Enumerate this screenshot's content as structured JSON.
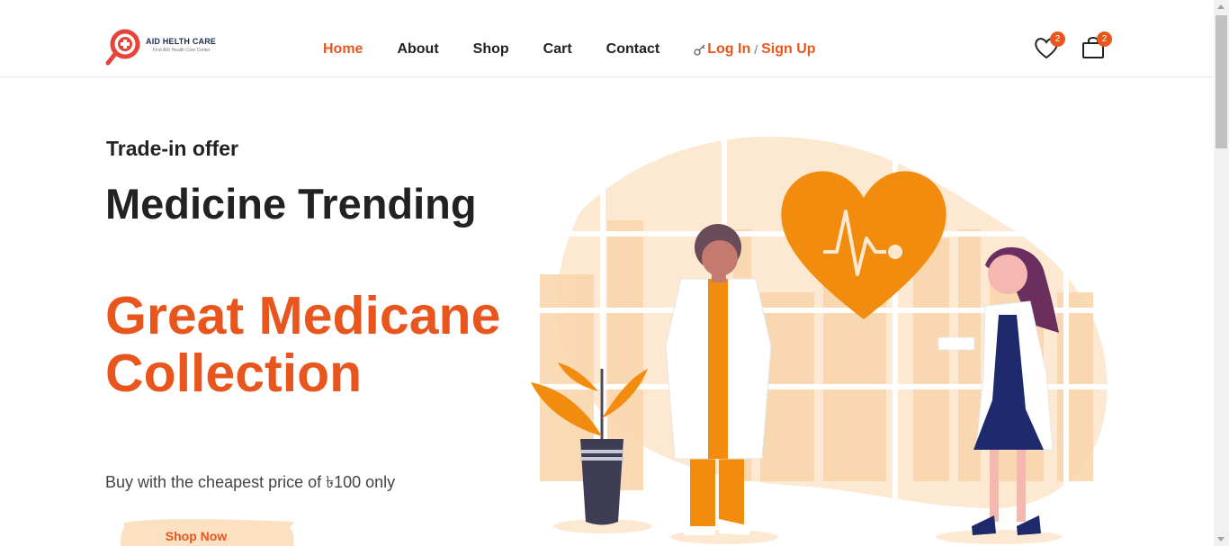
{
  "brand": {
    "name": "AID HELTH CARE",
    "tagline": "First AID Health Care Center"
  },
  "nav": {
    "home": "Home",
    "about": "About",
    "shop": "Shop",
    "cart": "Cart",
    "contact": "Contact",
    "login": "Log In",
    "separator": "/",
    "signup": "Sign Up"
  },
  "header_icons": {
    "wishlist_icon": "heart-icon",
    "wishlist_count": "2",
    "cart_icon": "shopping-bag-icon",
    "cart_count": "2"
  },
  "hero": {
    "offer": "Trade-in offer",
    "title_line1": "Medicine Trending",
    "title_line2": "Great Medicane Collection",
    "description": "Buy with the cheapest price of ৳100 only",
    "button": "Shop Now"
  },
  "colors": {
    "accent": "#e8561e",
    "illustration_orange": "#f28c0f",
    "illustration_peach": "#fde9d2"
  }
}
